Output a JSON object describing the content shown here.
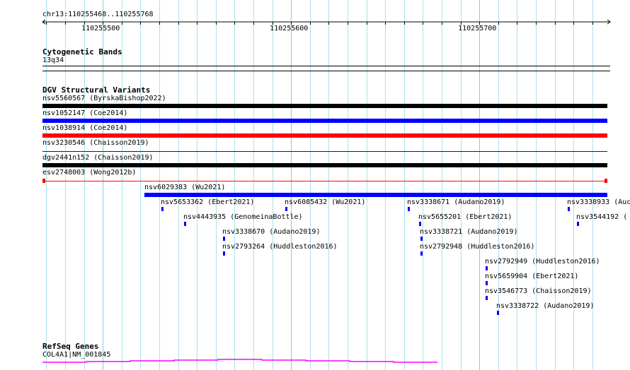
{
  "ruler": {
    "location": "chr13:110255468..110255768",
    "start": 110255468,
    "end": 110255768,
    "tick_labels": [
      "110255500",
      "110255600",
      "110255700"
    ]
  },
  "cytobands": {
    "title": "Cytogenetic Bands",
    "band": "13q34"
  },
  "dgv": {
    "title": "DGV Structural Variants",
    "features": [
      {
        "label": "nsv5560567 (ByrskaBishop2022)",
        "start": 110255468,
        "end": 110255768,
        "color": "#000000",
        "style": "thick"
      },
      {
        "label": "nsv1052147 (Coe2014)",
        "start": 110255468,
        "end": 110255768,
        "color": "#0000ff",
        "style": "thick"
      },
      {
        "label": "nsv1038914 (Coe2014)",
        "start": 110255468,
        "end": 110255768,
        "color": "#ff0000",
        "style": "thick"
      },
      {
        "label": "nsv3230546 (Chaisson2019)",
        "start": 110255468,
        "end": 110255768,
        "color": "#0000ff",
        "style": "thin"
      },
      {
        "label": "dgv2441n152 (Chaisson2019)",
        "start": 110255468,
        "end": 110255768,
        "color": "#000000",
        "style": "thick"
      },
      {
        "label": "esv2748003 (Wong2012b)",
        "start": 110255468,
        "end": 110255768,
        "color": "#ff0000",
        "style": "ends"
      },
      {
        "label": "nsv6029383 (Wu2021)",
        "start": 110255522,
        "end": 110255768,
        "color": "#0000ff",
        "style": "thick"
      }
    ],
    "small_features": [
      {
        "label": "nsv5653362 (Ebert2021)",
        "pos": 110255531,
        "row": 0
      },
      {
        "label": "nsv6085432 (Wu2021)",
        "pos": 110255597,
        "row": 0
      },
      {
        "label": "nsv3338671 (Audano2019)",
        "pos": 110255662,
        "row": 0
      },
      {
        "label": "nsv3338933 (Auc",
        "pos": 110255747,
        "row": 0
      },
      {
        "label": "nsv4443935 (GenomeinaBottle)",
        "pos": 110255543,
        "row": 1
      },
      {
        "label": "nsv5655201 (Ebert2021)",
        "pos": 110255668,
        "row": 1
      },
      {
        "label": "nsv3544192 (",
        "pos": 110255752,
        "row": 1
      },
      {
        "label": "nsv3338670 (Audano2019)",
        "pos": 110255564,
        "row": 2
      },
      {
        "label": "nsv3338721 (Audano2019)",
        "pos": 110255668.6,
        "row": 2
      },
      {
        "label": "nsv2793264 (Huddleston2016)",
        "pos": 110255564,
        "row": 3
      },
      {
        "label": "nsv2792948 (Huddleston2016)",
        "pos": 110255668.6,
        "row": 3
      },
      {
        "label": "nsv2792949 (Huddleston2016)",
        "pos": 110255703.5,
        "row": 4
      },
      {
        "label": "nsv5659904 (Ebert2021)",
        "pos": 110255703.5,
        "row": 5
      },
      {
        "label": "nsv3546773 (Chaisson2019)",
        "pos": 110255703.5,
        "row": 6
      },
      {
        "label": "nsv3338722 (Audano2019)",
        "pos": 110255709.5,
        "row": 7
      }
    ]
  },
  "refseq": {
    "title": "RefSeq Genes",
    "gene": "COL4A1|NM_001845",
    "color": "#ff00ff"
  }
}
